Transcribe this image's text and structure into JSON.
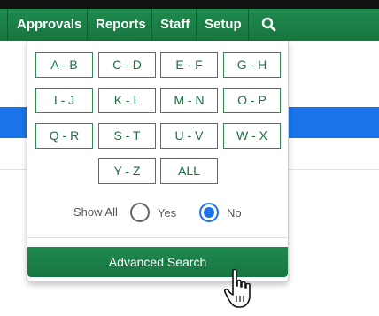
{
  "nav": {
    "items": [
      "Approvals",
      "Reports",
      "Staff",
      "Setup"
    ],
    "search_icon": "search-icon"
  },
  "letter_filter": {
    "buttons": [
      "A - B",
      "C - D",
      "E - F",
      "G - H",
      "I - J",
      "K - L",
      "M - N",
      "O - P",
      "Q - R",
      "S - T",
      "U - V",
      "W - X",
      "Y - Z",
      "ALL"
    ]
  },
  "show_all": {
    "label": "Show All",
    "options": [
      "Yes",
      "No"
    ],
    "selected": "No"
  },
  "advanced_search_label": "Advanced Search",
  "colors": {
    "nav_green": "#1e8a4d",
    "accent_blue": "#1a73e8"
  },
  "cursor_icon": "hand-pointer-icon"
}
